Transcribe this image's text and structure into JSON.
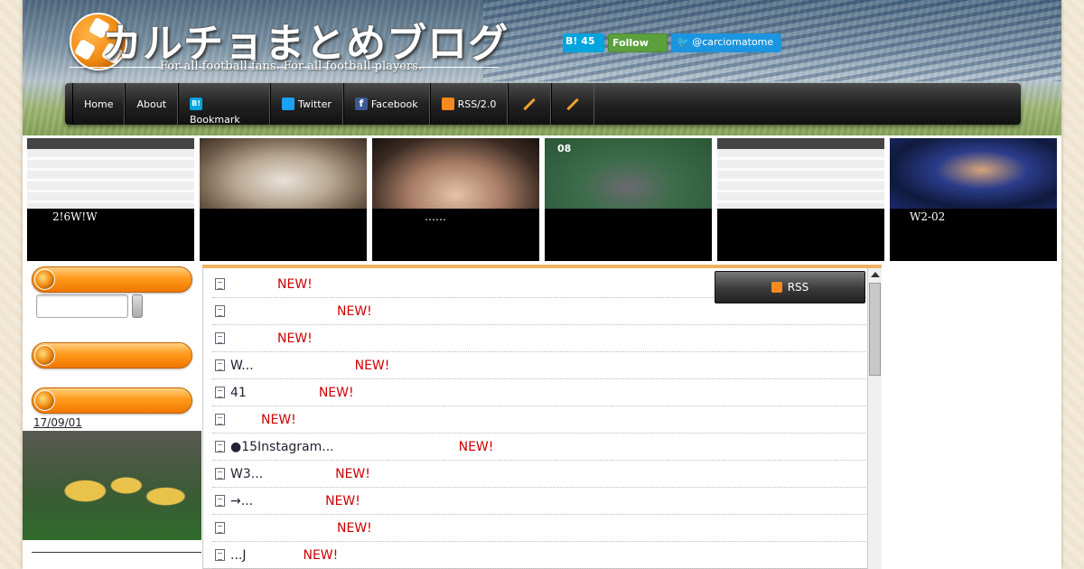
{
  "header": {
    "title": "カルチョまとめブログ",
    "subtitle": "For all football fans.  For all football players.",
    "hatena_count": "B! 45",
    "follow_label": "Follow",
    "twitter_handle": "@carciomatome"
  },
  "nav": {
    "items": [
      {
        "label": "Home"
      },
      {
        "label": "About"
      },
      {
        "label": "Bookmark",
        "icon": "hatena-bookmark-icon"
      },
      {
        "label": "Twitter",
        "icon": "twitter-icon"
      },
      {
        "label": "Facebook",
        "icon": "facebook-icon"
      },
      {
        "label": "RSS/2.0",
        "icon": "rss-icon"
      }
    ],
    "icon_labels": {
      "hatena": "B!",
      "facebook": "f"
    }
  },
  "thumbnails": [
    {
      "caption": "2!6W!W"
    },
    {
      "caption": ""
    },
    {
      "caption": "……"
    },
    {
      "caption": "08"
    },
    {
      "caption": ""
    },
    {
      "caption": "W2-02"
    }
  ],
  "sidebar": {
    "date": "17/09/01"
  },
  "main": {
    "rss_label": "RSS",
    "new_label": "NEW!",
    "rows": [
      {
        "text": ""
      },
      {
        "text": ""
      },
      {
        "text": ""
      },
      {
        "text": "W..."
      },
      {
        "text": "41"
      },
      {
        "text": ""
      },
      {
        "text": "●15Instagram..."
      },
      {
        "text": "W3..."
      },
      {
        "text": "→..."
      },
      {
        "text": ""
      },
      {
        "text": "...J"
      }
    ]
  },
  "colors": {
    "accent_orange": "#f07800",
    "new_red": "#cc0000",
    "nav_dark": "#232323",
    "twitter_blue": "#1b95e0"
  }
}
